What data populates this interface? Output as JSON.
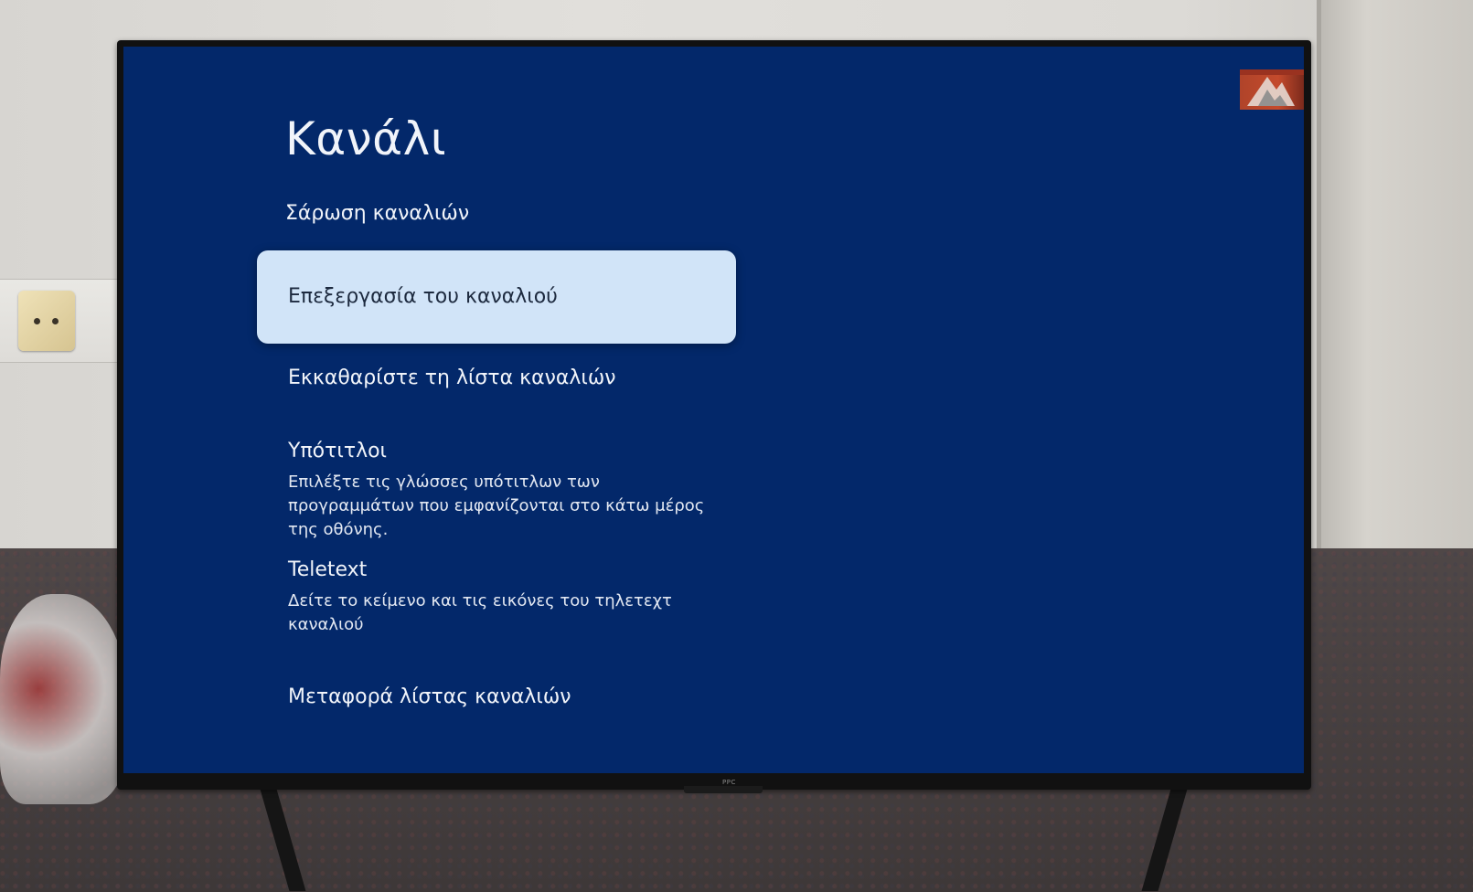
{
  "screen": {
    "page_title": "Κανάλι",
    "section_header": "Σάρωση καναλιών",
    "menu": [
      {
        "title": "Επεξεργασία του καναλιού",
        "focused": true
      },
      {
        "title": "Εκκαθαρίστε τη λίστα καναλιών",
        "focused": false
      },
      {
        "title": "Υπότιτλοι",
        "subtitle": "Επιλέξτε τις γλώσσες υπότιτλων των προγραμμάτων που εμφανίζονται στο κάτω μέρος της οθόνης.",
        "focused": false
      },
      {
        "title": "Teletext",
        "subtitle": "Δείτε το κείμενο και τις εικόνες του τηλετεχτ καναλιού",
        "focused": false
      },
      {
        "title": "Μεταφορά λίστας καναλιών",
        "focused": false
      }
    ]
  },
  "tv": {
    "brand": "PPC"
  },
  "colors": {
    "screen_background": "#03286a",
    "focused_item_background": "#d1e4f8",
    "text_primary": "#f1f4fa",
    "focused_text": "#1d2a3f"
  },
  "icons": {
    "corner_logo": "channel-logo-icon"
  }
}
